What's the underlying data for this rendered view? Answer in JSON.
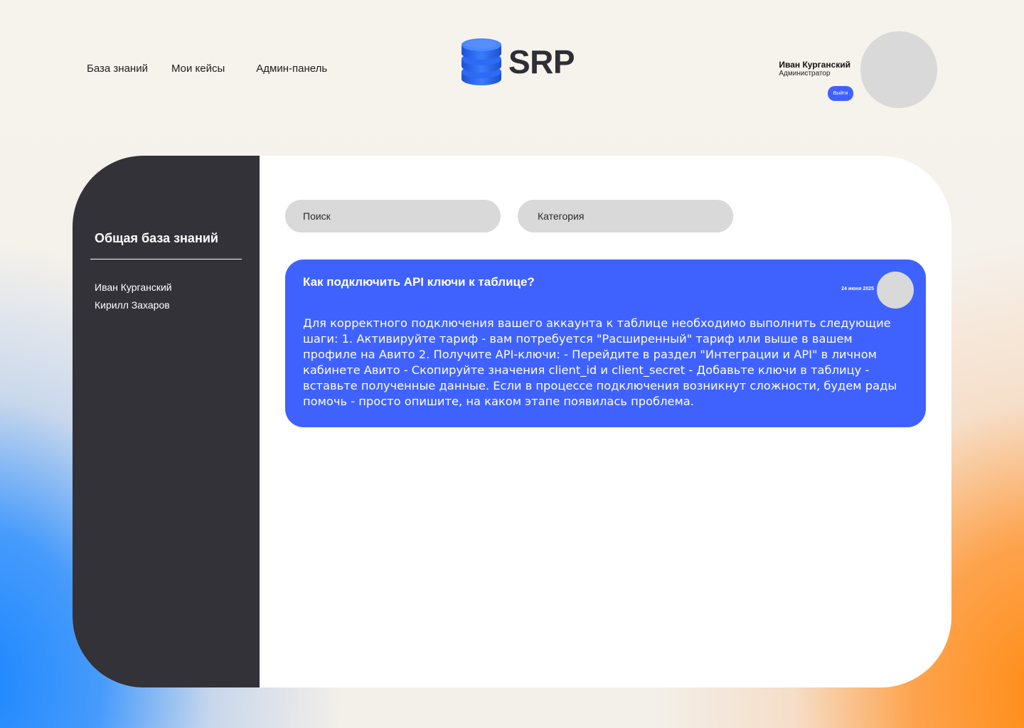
{
  "nav": {
    "items": [
      "База знаний",
      "Мои кейсы",
      "Админ-панель"
    ]
  },
  "logo": {
    "text": "SRP",
    "icon": "database-icon"
  },
  "user": {
    "name": "Иван Курганский",
    "role": "Администратор",
    "logout_label": "Выйти"
  },
  "sidebar": {
    "title": "Общая база знаний",
    "items": [
      "Иван Курганский",
      "Кирилл Захаров"
    ]
  },
  "filters": {
    "search_placeholder": "Поиск",
    "category_placeholder": "Категория"
  },
  "article": {
    "title": "Как подключить API ключи к таблице?",
    "date": "24 июня 2025",
    "body": "Для корректного подключения вашего аккаунта к таблице необходимо выполнить следующие шаги: 1. Активируйте тариф - вам потребуется \"Расширенный\" тариф или выше в вашем профиле на Авито 2. Получите API-ключи: - Перейдите в раздел \"Интеграции и API\" в личном кабинете Авито - Скопируйте значения client_id и client_secret - Добавьте ключи в таблицу - вставьте полученные данные.  Если в процессе подключения возникнут сложности, будем рады помочь - просто опишите, на каком этапе появилась проблема."
  },
  "colors": {
    "accent": "#3f62ff",
    "sidebar_bg": "#323238",
    "placeholder_gray": "#d9d9d9"
  }
}
